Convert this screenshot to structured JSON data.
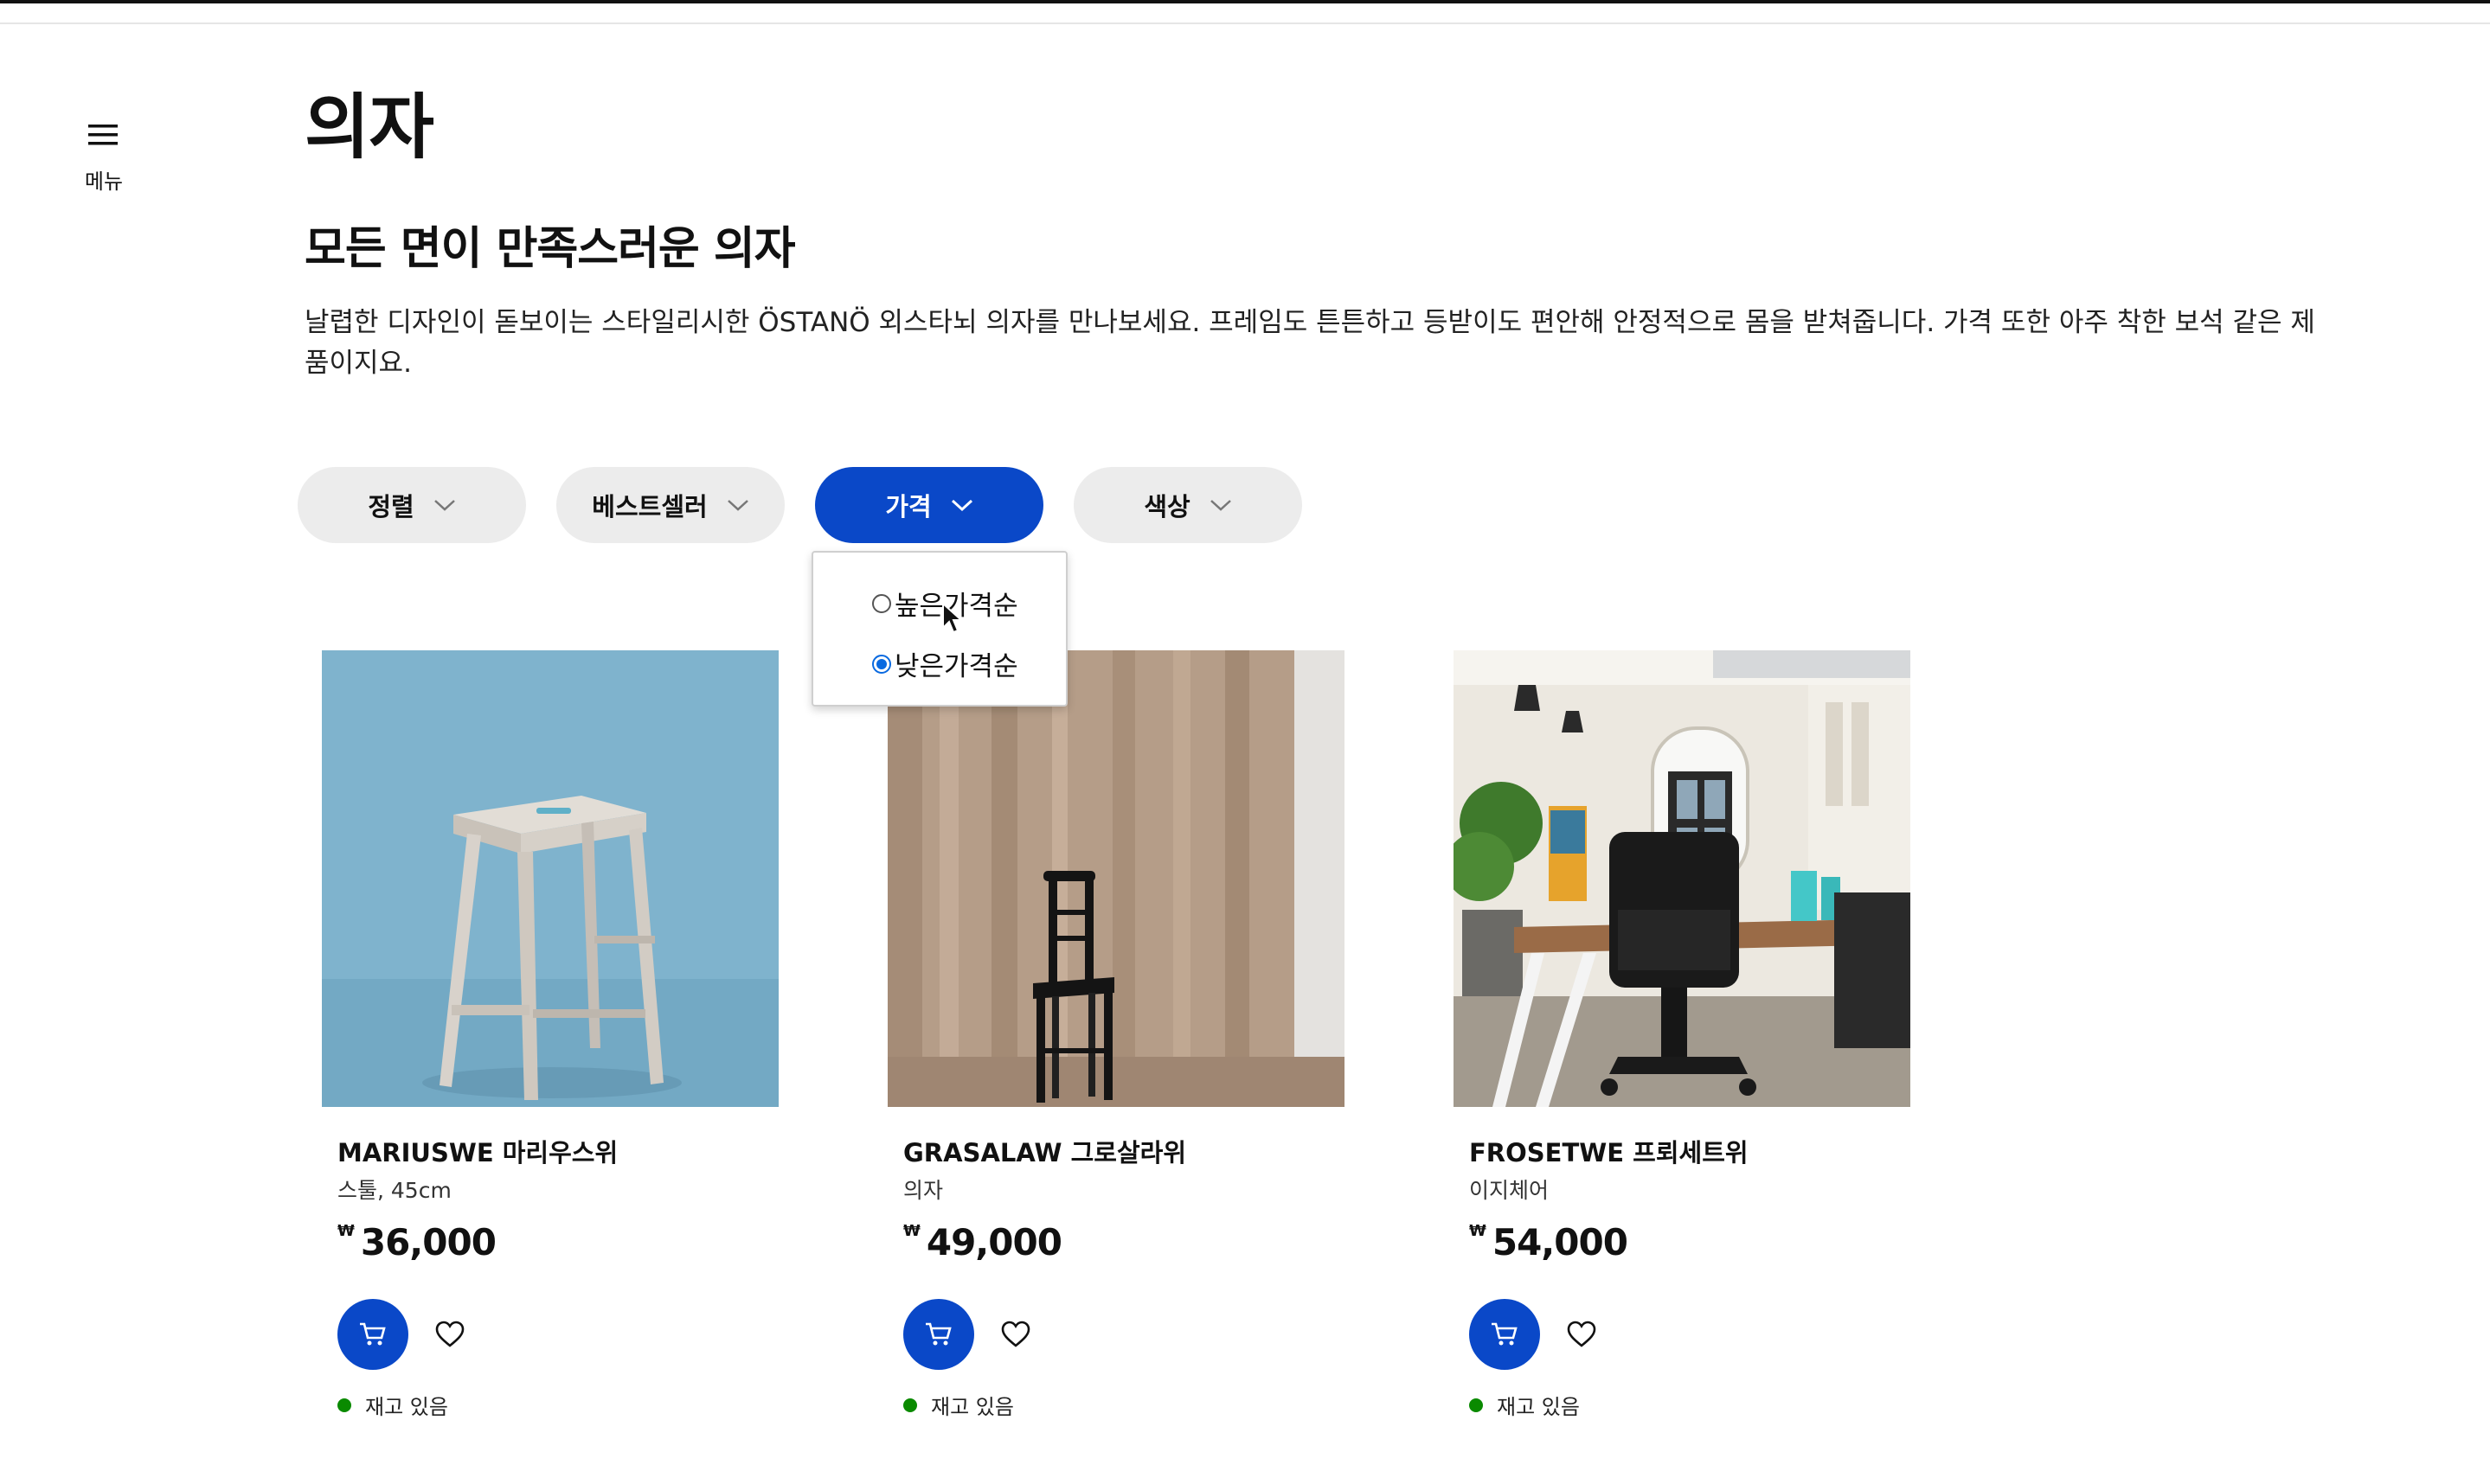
{
  "menu": {
    "label": "메뉴",
    "icon": "hamburger-icon"
  },
  "page": {
    "title": "의자",
    "subtitle": "모든 면이 만족스러운 의자",
    "description": "날렵한 디자인이 돋보이는 스타일리시한 ÖSTANÖ 외스타뇌 의자를 만나보세요. 프레임도 튼튼하고 등받이도 편안해 안정적으로 몸을 받쳐줍니다. 가격 또한 아주 착한 보석 같은 제품이지요."
  },
  "filters": [
    {
      "label": "정렬",
      "active": false
    },
    {
      "label": "베스트셀러",
      "active": false
    },
    {
      "label": "가격",
      "active": true
    },
    {
      "label": "색상",
      "active": false
    }
  ],
  "price_dropdown": {
    "options": [
      {
        "label": "높은가격순",
        "selected": false
      },
      {
        "label": "낮은가격순",
        "selected": true
      }
    ]
  },
  "products": [
    {
      "name": "MARIUSWE 마리우스위",
      "desc": "스툴, 45cm",
      "currency": "₩",
      "price": "36,000",
      "stock": "재고 있음"
    },
    {
      "name": "GRASALAW 그로살라위",
      "desc": "의자",
      "currency": "₩",
      "price": "49,000",
      "stock": "재고 있음"
    },
    {
      "name": "FROSETWE 프뢰세트위",
      "desc": "이지체어",
      "currency": "₩",
      "price": "54,000",
      "stock": "재고 있음"
    }
  ],
  "colors": {
    "accent": "#0a48c8",
    "pill_bg": "#ececec",
    "in_stock": "#0a8a00",
    "radio_selected": "#0a6ae0"
  }
}
